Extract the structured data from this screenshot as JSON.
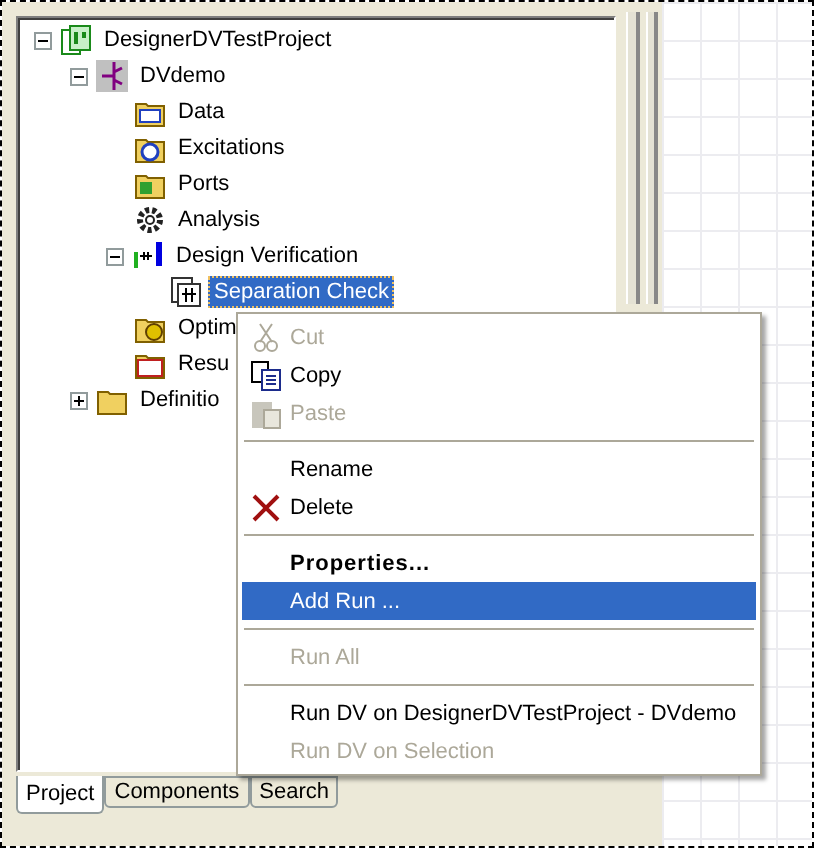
{
  "tree": [
    {
      "label": "DesignerDVTestProject",
      "kind": "project",
      "expanded": true,
      "selected": false,
      "children": [
        {
          "label": "DVdemo",
          "kind": "design",
          "expanded": true,
          "selected": false,
          "children": [
            {
              "label": "Data",
              "kind": "data",
              "selected": false
            },
            {
              "label": "Excitations",
              "kind": "excitations",
              "selected": false
            },
            {
              "label": "Ports",
              "kind": "ports",
              "selected": false
            },
            {
              "label": "Analysis",
              "kind": "gear",
              "selected": false
            },
            {
              "label": "Design Verification",
              "kind": "verification",
              "expanded": true,
              "selected": false,
              "children": [
                {
                  "label": "Separation Check",
                  "kind": "check",
                  "selected": true
                }
              ]
            },
            {
              "label": "Optim",
              "kind": "optim",
              "selected": false
            },
            {
              "label": "Resu",
              "kind": "results",
              "selected": false
            }
          ]
        },
        {
          "label": "Definitio",
          "kind": "folder",
          "expanded": false,
          "selected": false
        }
      ]
    }
  ],
  "tabs": [
    {
      "label": "Project",
      "selected": true
    },
    {
      "label": "Components",
      "selected": false
    },
    {
      "label": "Search",
      "selected": false
    }
  ],
  "context_menu": [
    {
      "kind": "cut",
      "label": "Cut",
      "disabled": true,
      "selected": false,
      "bold": false
    },
    {
      "kind": "copy",
      "label": "Copy",
      "disabled": false,
      "selected": false,
      "bold": false
    },
    {
      "kind": "paste",
      "label": "Paste",
      "disabled": true,
      "selected": false,
      "bold": false
    },
    {
      "kind": "separator"
    },
    {
      "kind": "item",
      "label": "Rename",
      "disabled": false,
      "selected": false,
      "bold": false
    },
    {
      "kind": "delete",
      "label": "Delete",
      "disabled": false,
      "selected": false,
      "bold": false
    },
    {
      "kind": "separator"
    },
    {
      "kind": "item",
      "label": "Properties...",
      "disabled": false,
      "selected": false,
      "bold": true
    },
    {
      "kind": "item",
      "label": "Add Run ...",
      "disabled": false,
      "selected": true,
      "bold": false
    },
    {
      "kind": "separator"
    },
    {
      "kind": "item",
      "label": "Run All",
      "disabled": true,
      "selected": false,
      "bold": false
    },
    {
      "kind": "separator"
    },
    {
      "kind": "item",
      "label": "Run DV on DesignerDVTestProject - DVdemo",
      "disabled": false,
      "selected": false,
      "bold": false
    },
    {
      "kind": "item",
      "label": "Run DV on Selection",
      "disabled": true,
      "selected": false,
      "bold": false
    }
  ]
}
